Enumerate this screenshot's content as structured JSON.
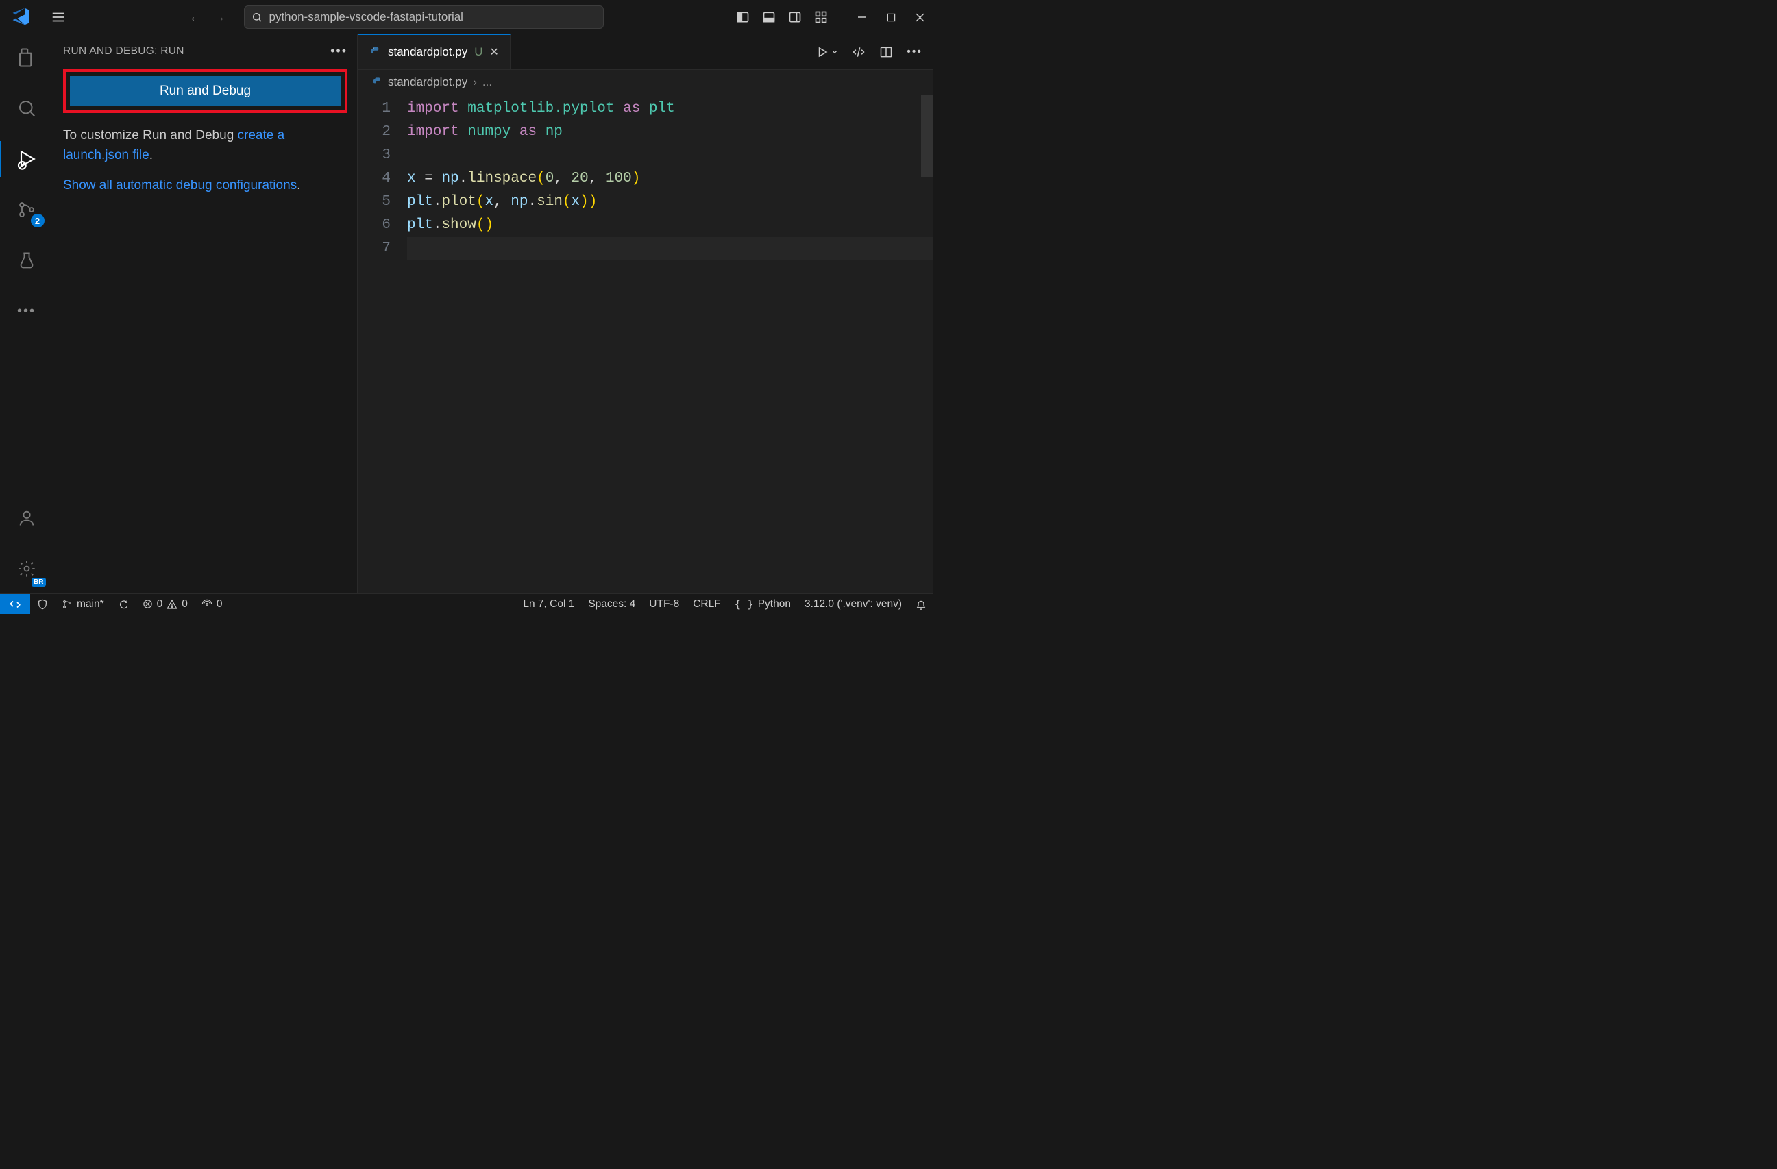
{
  "titlebar": {
    "search_text": "python-sample-vscode-fastapi-tutorial"
  },
  "sidebar": {
    "title": "RUN AND DEBUG: RUN",
    "run_button_label": "Run and Debug",
    "customize_text": "To customize Run and Debug",
    "create_link": "create a launch.json file",
    "period": ".",
    "show_link": "Show all automatic debug configurations",
    "period2": "."
  },
  "activitybar": {
    "scm_badge": "2"
  },
  "tab": {
    "filename": "standardplot.py",
    "modified": "U"
  },
  "breadcrumb": {
    "file": "standardplot.py",
    "crumb_more": "..."
  },
  "code": {
    "line1_import": "import",
    "line1_mod": "matplotlib.pyplot",
    "line1_as": "as",
    "line1_alias": "plt",
    "line2_import": "import",
    "line2_mod": "numpy",
    "line2_as": "as",
    "line2_alias": "np",
    "line4_x": "x",
    "line4_eq": "=",
    "line4_np": "np",
    "line4_fn": "linspace",
    "line4_a0": "0",
    "line4_a1": "20",
    "line4_a2": "100",
    "line5_obj": "plt",
    "line5_fn": "plot",
    "line5_x": "x",
    "line5_np": "np",
    "line5_sin": "sin",
    "line5_xx": "x",
    "line6_obj": "plt",
    "line6_fn": "show",
    "lines": [
      "1",
      "2",
      "3",
      "4",
      "5",
      "6",
      "7"
    ]
  },
  "statusbar": {
    "branch": "main*",
    "errors": "0",
    "warnings": "0",
    "ports": "0",
    "cursor": "Ln 7, Col 1",
    "spaces": "Spaces: 4",
    "encoding": "UTF-8",
    "eol": "CRLF",
    "language": "Python",
    "interpreter": "3.12.0 ('.venv': venv)"
  }
}
